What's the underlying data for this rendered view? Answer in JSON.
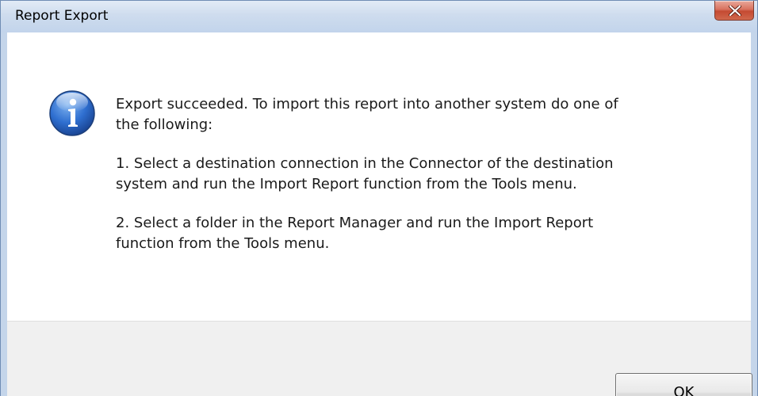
{
  "window": {
    "title": "Report Export"
  },
  "dialog": {
    "icon": "information-icon",
    "paragraphs": [
      "Export succeeded. To import this report into another system do one of the following:",
      "1. Select a destination connection in the Connector of the destination system and run the Import Report function from the Tools menu.",
      "2. Select a folder in the Report Manager and run the Import Report function from the Tools menu."
    ],
    "lines": [
      [
        "Export succeeded. To import this report into another system do one of",
        "the following:"
      ],
      [
        "1. Select a destination connection in the Connector of the destination",
        "system and run the Import Report function from the Tools menu."
      ],
      [
        "2. Select a folder in the Report Manager and run the Import Report",
        "function from the Tools menu."
      ]
    ]
  },
  "buttons": {
    "ok_label": "OK"
  },
  "colors": {
    "titlebar": "#c4d5ea",
    "close_button": "#c44a32",
    "button_bar": "#f0f0f0"
  }
}
